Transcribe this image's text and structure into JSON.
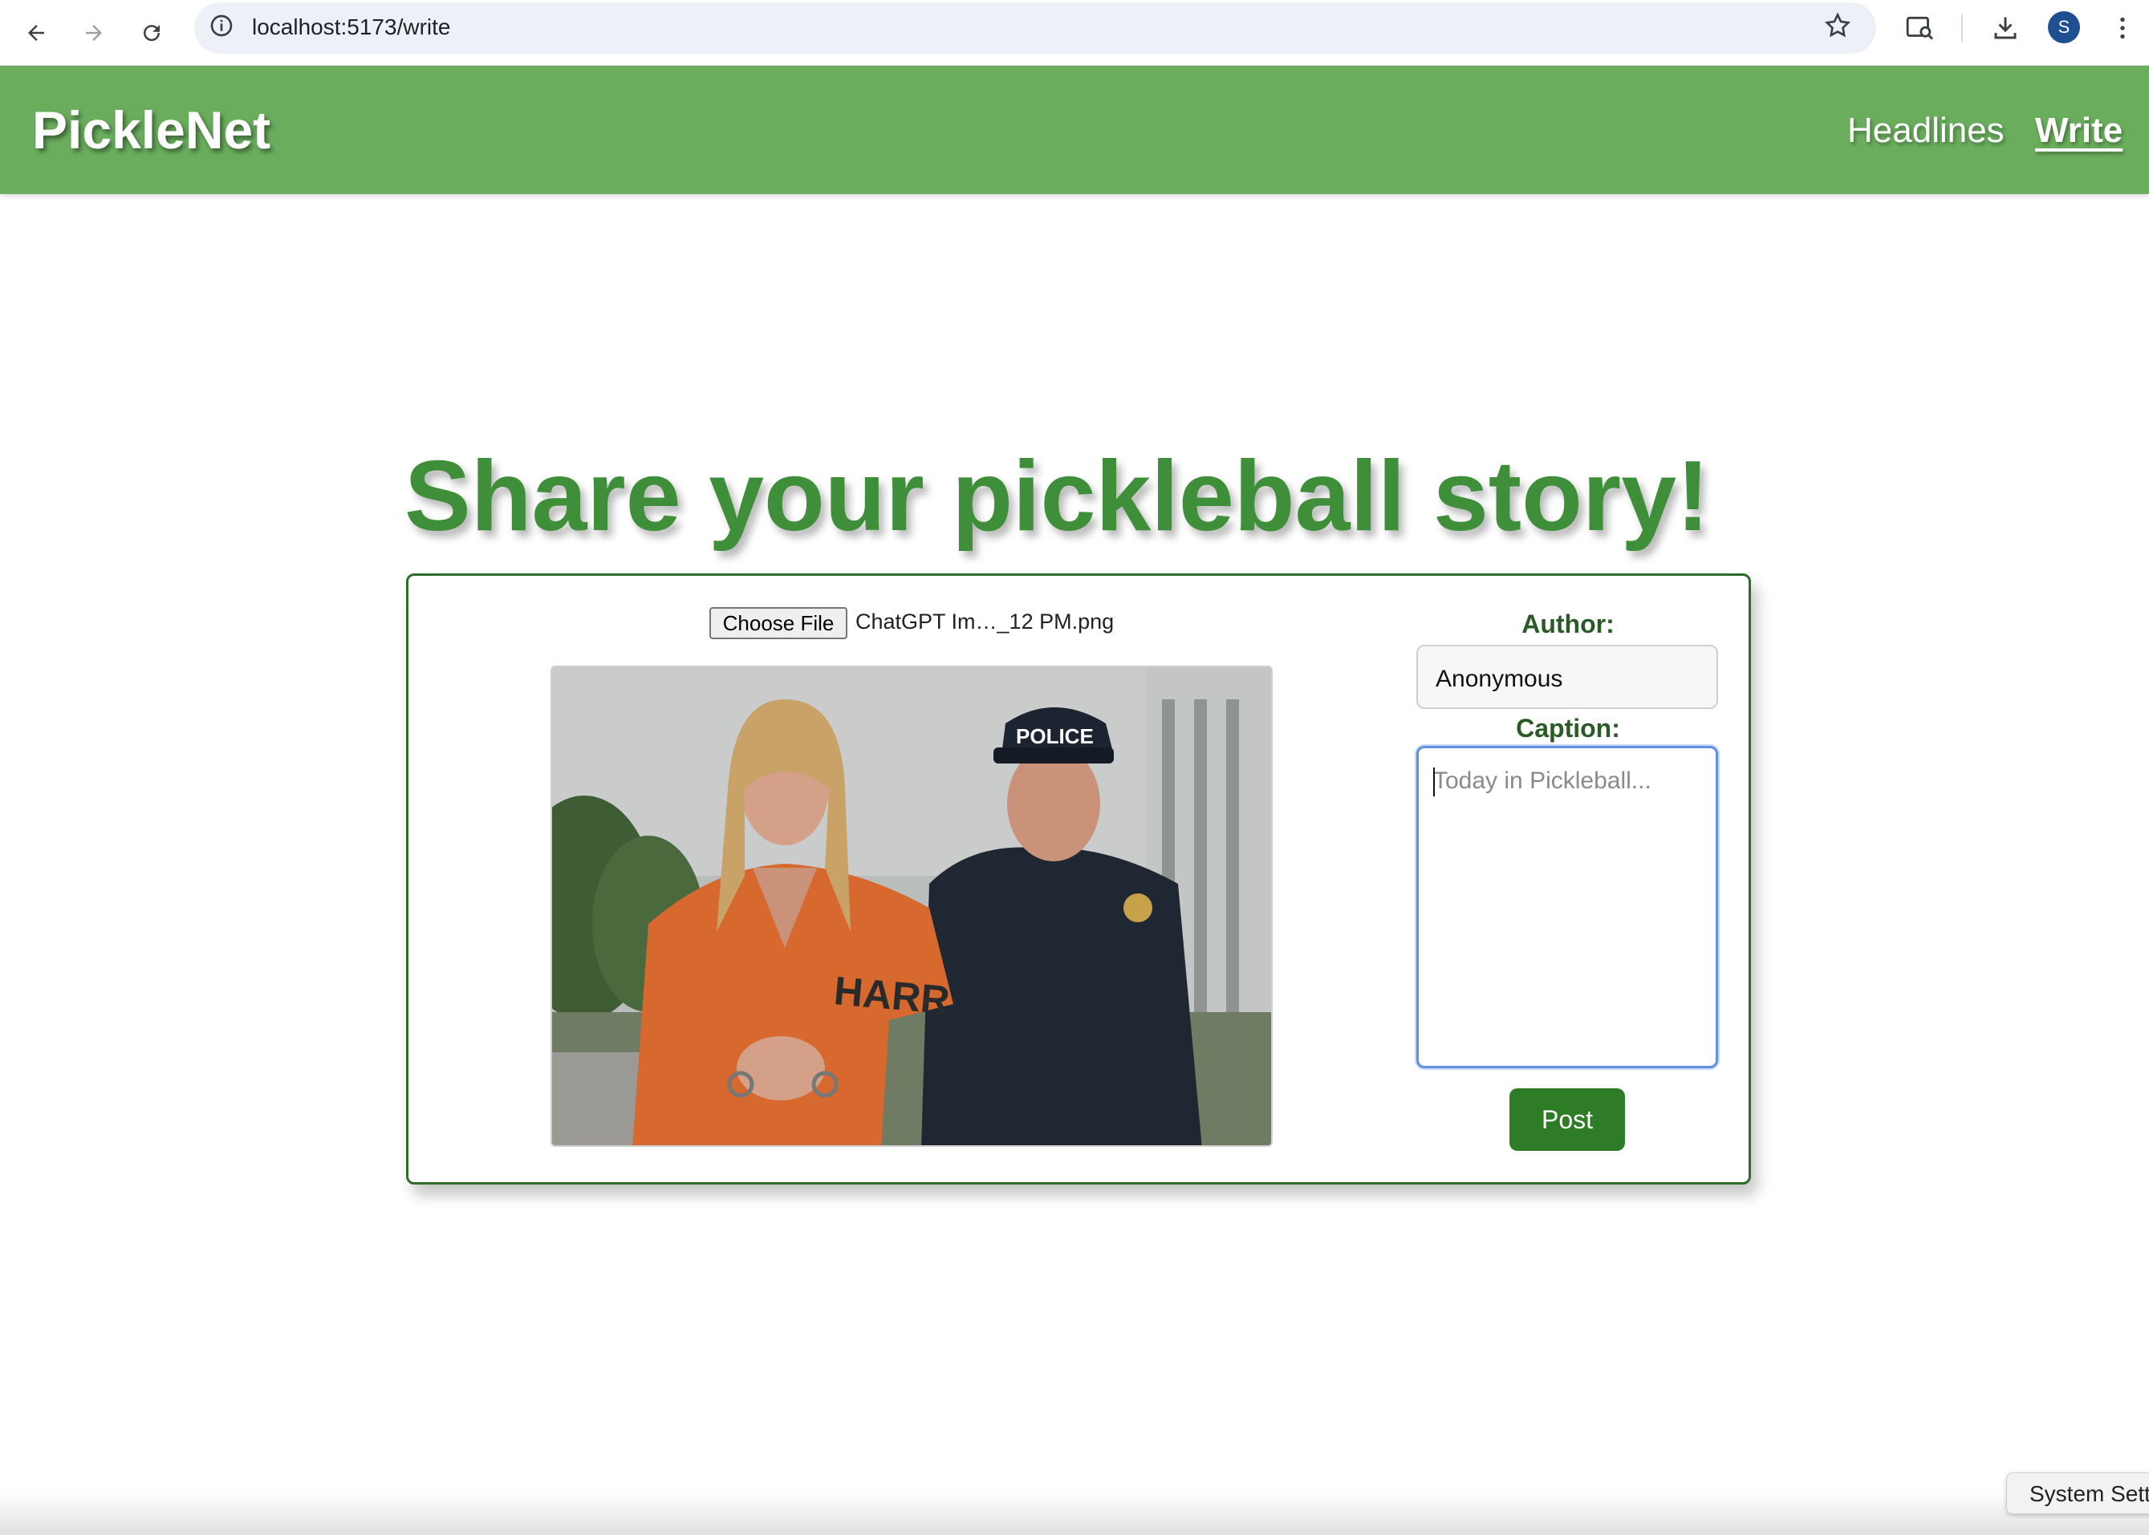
{
  "browser": {
    "url": "localhost:5173/write",
    "profile_initial": "S"
  },
  "app": {
    "brand": "PickleNet",
    "nav": {
      "headlines": "Headlines",
      "write": "Write"
    }
  },
  "page": {
    "heading": "Share your pickleball story!"
  },
  "form": {
    "file_button": "Choose File",
    "file_name": "ChatGPT Im…_12 PM.png",
    "photo_text": {
      "cap_text": "POLICE",
      "shirt_text": "HARR"
    },
    "author_label": "Author:",
    "author_value": "Anonymous",
    "caption_label": "Caption:",
    "caption_placeholder": "Today in Pickleball...",
    "post_button": "Post"
  },
  "system": {
    "tooltip": "System Sett"
  },
  "colors": {
    "header_green": "#6aae5d",
    "heading_green": "#3f8f3a",
    "button_green": "#2e7d26",
    "label_green": "#2a5a26"
  }
}
